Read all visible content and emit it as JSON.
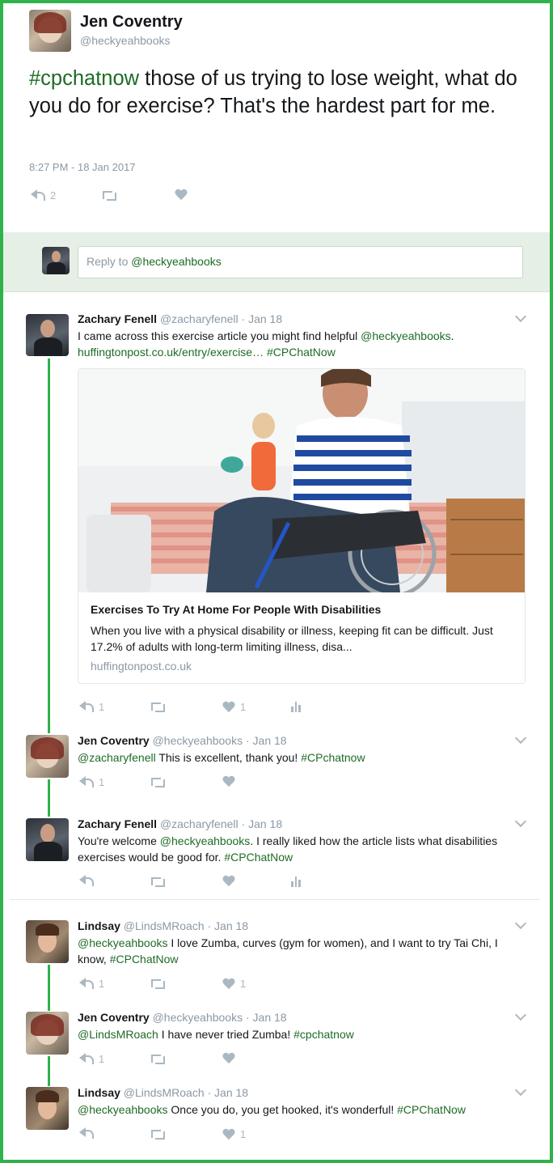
{
  "main_tweet": {
    "name": "Jen Coventry",
    "handle": "@heckyeahbooks",
    "hashtag": "#cpchatnow",
    "text": " those of us trying to lose weight, what do you do for exercise? That's the hardest part for me.",
    "timestamp": "8:27 PM - 18 Jan 2017",
    "reply_count": "2"
  },
  "reply_box": {
    "placeholder_prefix": "Reply to ",
    "placeholder_handle": "@heckyeahbooks"
  },
  "replies": [
    {
      "name": "Zachary Fenell",
      "handle": "@zacharyfenell",
      "date": "· Jan 18",
      "text1": "I came across this exercise article you might find helpful ",
      "mention": "@heckyeahbooks",
      "text2": ".",
      "link": "huffingtonpost.co.uk/entry/exercise…",
      "hashtag": "#CPChatNow",
      "card": {
        "title": "Exercises To Try At Home For People With Disabilities",
        "description": "When you live with a physical disability or illness, keeping fit can be difficult.  Just 17.2% of adults with long-term limiting illness, disa...",
        "domain": "huffingtonpost.co.uk"
      },
      "reply_count": "1",
      "like_count": "1"
    },
    {
      "name": "Jen Coventry",
      "handle": "@heckyeahbooks",
      "date": "· Jan 18",
      "mention": "@zacharyfenell",
      "text": " This is excellent, thank you! ",
      "hashtag": "#CPchatnow",
      "reply_count": "1"
    },
    {
      "name": "Zachary Fenell",
      "handle": "@zacharyfenell",
      "date": "· Jan 18",
      "text1": "You're welcome ",
      "mention": "@heckyeahbooks",
      "text2": ". I really liked how the article lists what disabilities exercises would be good for. ",
      "hashtag": "#CPChatNow"
    },
    {
      "name": "Lindsay",
      "handle": "@LindsMRoach",
      "date": "· Jan 18",
      "mention": "@heckyeahbooks",
      "text": " I love Zumba, curves (gym for women), and I want to try Tai Chi, I know, ",
      "hashtag": "#CPChatNow",
      "reply_count": "1",
      "like_count": "1"
    },
    {
      "name": "Jen Coventry",
      "handle": "@heckyeahbooks",
      "date": "· Jan 18",
      "mention": "@LindsMRoach",
      "text": " I have never tried Zumba! ",
      "hashtag": "#cpchatnow",
      "reply_count": "1"
    },
    {
      "name": "Lindsay",
      "handle": "@LindsMRoach",
      "date": "· Jan 18",
      "mention": "@heckyeahbooks",
      "text": " Once you do, you get hooked, it's wonderful! ",
      "hashtag": "#CPChatNow",
      "like_count": "1"
    }
  ],
  "colors": {
    "frame": "#2fb24a",
    "link": "#1e6b25",
    "reply_area": "#e6efe6",
    "icon": "#aab8c2"
  }
}
